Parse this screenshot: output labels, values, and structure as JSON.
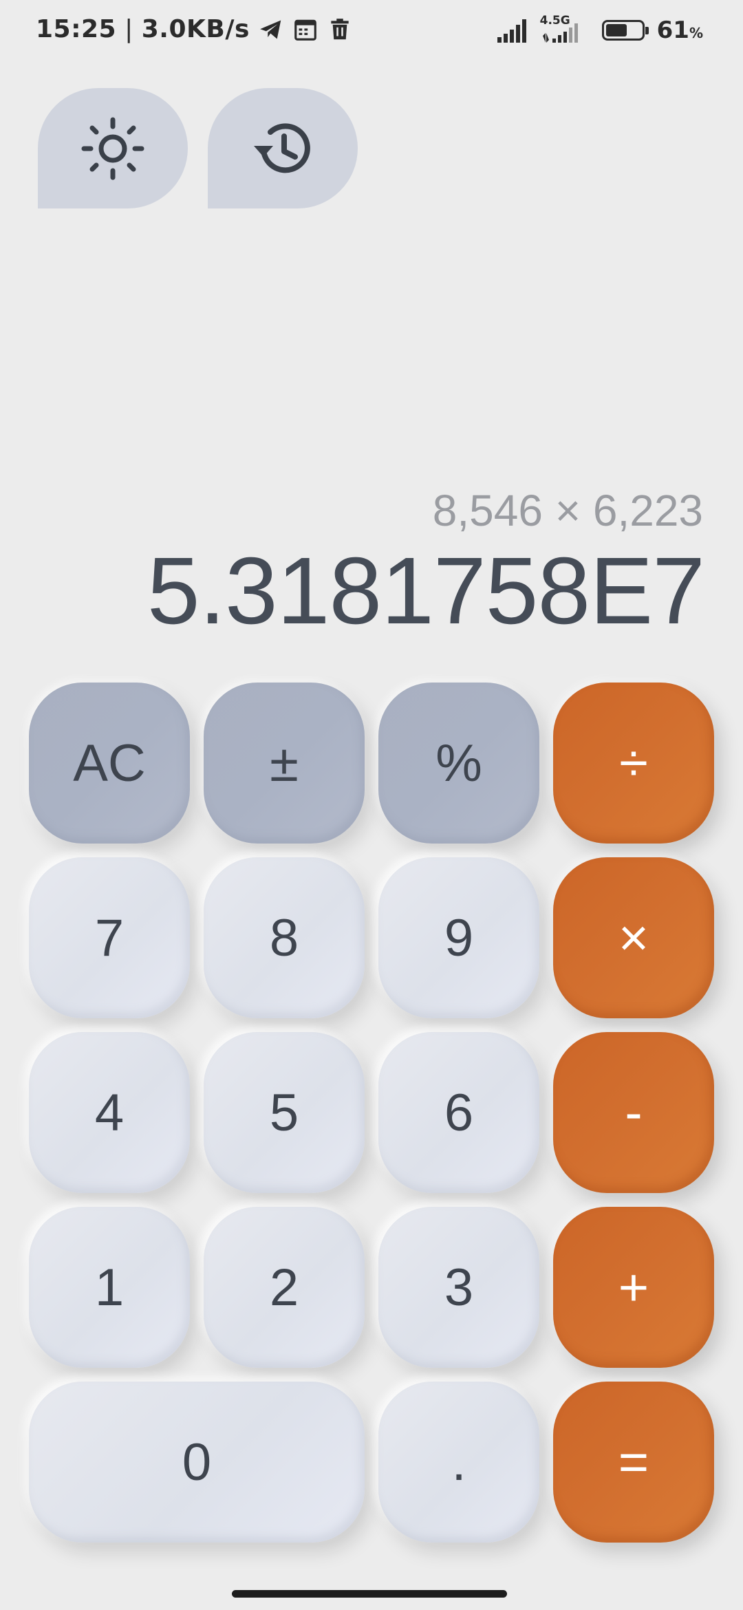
{
  "status_bar": {
    "time": "15:25",
    "separator": "|",
    "speed": "3.0KB/s",
    "network_type": "4.5G",
    "battery_percent": "61",
    "battery_unit": "%",
    "battery_level": 0.61,
    "icons": [
      "telegram-icon",
      "calendar-icon",
      "trash-icon",
      "signal-icon",
      "signal-2-icon",
      "battery-icon"
    ]
  },
  "top_buttons": {
    "theme_icon": "brightness-icon",
    "history_icon": "history-icon"
  },
  "display": {
    "expression": "8,546 × 6,223",
    "result": "5.3181758E7"
  },
  "keys": {
    "ac": "AC",
    "plus_minus": "±",
    "percent": "%",
    "divide": "÷",
    "seven": "7",
    "eight": "8",
    "nine": "9",
    "multiply": "×",
    "four": "4",
    "five": "5",
    "six": "6",
    "minus": "-",
    "one": "1",
    "two": "2",
    "three": "3",
    "plus": "+",
    "zero": "0",
    "decimal": ".",
    "equals": "="
  },
  "colors": {
    "background": "#ececec",
    "number_key": "#e1e4ec",
    "function_key": "#aab2c4",
    "operator_key": "#d26f2f",
    "result_text": "#454c57",
    "expression_text": "#9a9ca1"
  }
}
